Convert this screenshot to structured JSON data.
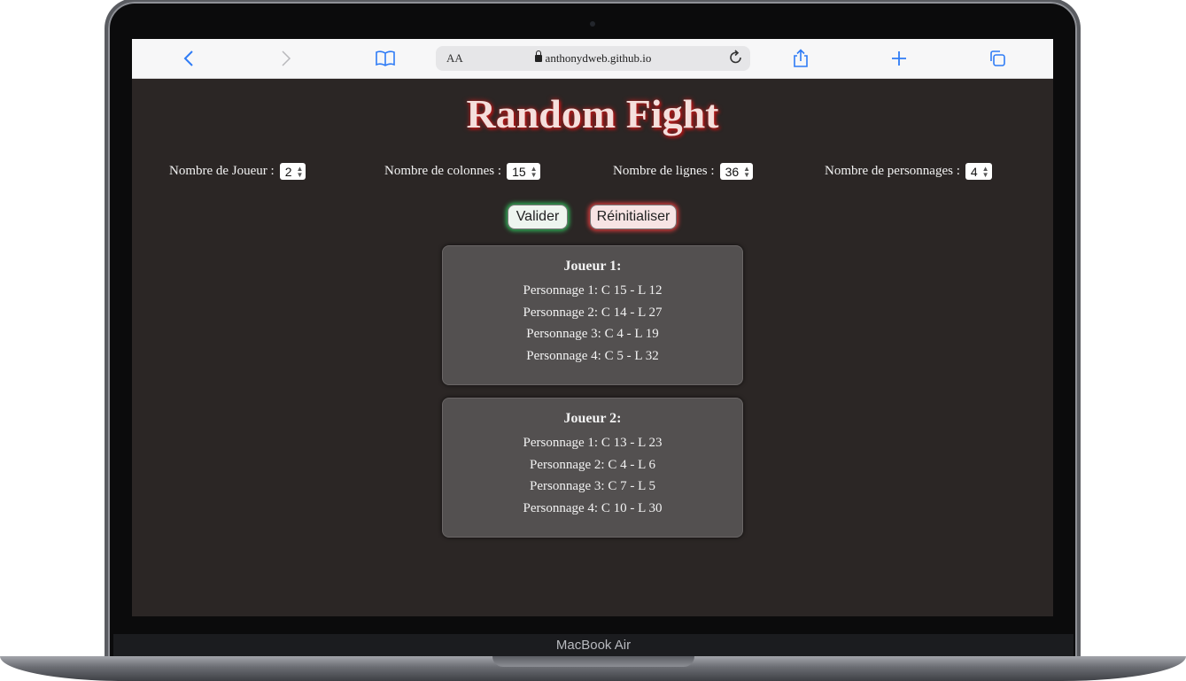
{
  "device": {
    "label": "MacBook Air"
  },
  "browser": {
    "text_size_label": "AA",
    "url": "anthonydweb.github.io",
    "icons": {
      "back": "chevron-left-icon",
      "forward": "chevron-right-icon",
      "bookmarks": "book-icon",
      "reload": "reload-icon",
      "share": "share-icon",
      "new_tab": "plus-icon",
      "tabs": "tabs-icon"
    }
  },
  "page": {
    "title": "Random Fight",
    "settings": [
      {
        "label": "Nombre de Joueur :",
        "value": "2"
      },
      {
        "label": "Nombre de colonnes :",
        "value": "15"
      },
      {
        "label": "Nombre de lignes :",
        "value": "36"
      },
      {
        "label": "Nombre de personnages :",
        "value": "4"
      }
    ],
    "buttons": {
      "validate": "Valider",
      "reset": "Réinitialiser"
    },
    "players": [
      {
        "title": "Joueur 1:",
        "characters": [
          "Personnage 1: C 15 - L 12",
          "Personnage 2: C 14 - L 27",
          "Personnage 3: C 4 - L 19",
          "Personnage 4: C 5 - L 32"
        ]
      },
      {
        "title": "Joueur 2:",
        "characters": [
          "Personnage 1: C 13 - L 23",
          "Personnage 2: C 4 - L 6",
          "Personnage 3: C 7 - L 5",
          "Personnage 4: C 10 - L 30"
        ]
      }
    ]
  },
  "colors": {
    "page_background": "#2b2625",
    "title_glow": "#c81e1e",
    "validate_glow": "#2fae55",
    "reset_glow": "#d23a3a",
    "card_background": "#535050",
    "browser_accent": "#2f7cf6"
  }
}
